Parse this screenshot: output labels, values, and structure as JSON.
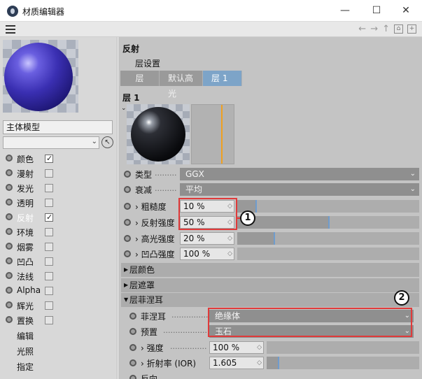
{
  "window": {
    "title": "材质编辑器",
    "controls": {
      "minimize": "—",
      "maximize": "☐",
      "close": "✕"
    }
  },
  "toolbar": {
    "icons": [
      "menu-icon",
      "back-arrow-icon",
      "forward-arrow-icon",
      "up-arrow-icon",
      "lock-icon",
      "new-window-icon"
    ],
    "back": "←",
    "forward": "→",
    "up": "↑",
    "lock": "🔒",
    "new_window": "⊞"
  },
  "left": {
    "material_name": "主体模型",
    "channels": [
      {
        "label": "颜色",
        "checked": true
      },
      {
        "label": "漫射",
        "checked": false
      },
      {
        "label": "发光",
        "checked": false
      },
      {
        "label": "透明",
        "checked": false
      },
      {
        "label": "反射",
        "checked": true,
        "active": true
      },
      {
        "label": "环境",
        "checked": false
      },
      {
        "label": "烟雾",
        "checked": false
      },
      {
        "label": "凹凸",
        "checked": false
      },
      {
        "label": "法线",
        "checked": false
      },
      {
        "label": "Alpha",
        "checked": false
      },
      {
        "label": "辉光",
        "checked": false
      },
      {
        "label": "置换",
        "checked": false
      }
    ],
    "extra_items": [
      "编辑",
      "光照",
      "指定"
    ]
  },
  "right": {
    "section_title": "反射",
    "layer_settings_label": "层设置",
    "layer_tabs": [
      "层",
      "默认高光",
      "层 1"
    ],
    "layer_header": "层 1",
    "type_label": "类型",
    "type_value": "GGX",
    "attenuation_label": "衰减",
    "attenuation_value": "平均",
    "roughness_label": "› 粗糙度",
    "roughness_value": "10 %",
    "roughness": 0.1,
    "reflect_label": "› 反射强度",
    "reflect_value": "50 %",
    "reflect": 0.5,
    "specular_label": "› 高光强度",
    "specular_value": "20 %",
    "specular": 0.2,
    "bump_label": "› 凹凸强度",
    "bump_value": "100 %",
    "bump": 1.0,
    "groups": [
      "层颜色",
      "层遮罩",
      "层菲涅耳"
    ],
    "fresnel_label": "菲涅耳",
    "fresnel_value": "绝缘体",
    "preset_label": "预置",
    "preset_value": "玉石",
    "strength_label": "› 强度",
    "strength_value": "100 %",
    "ior_label": "› 折射率 (IOR)",
    "ior_value": "1.605",
    "last_label": "反向"
  },
  "callouts": [
    "1",
    "2"
  ],
  "colors": {
    "highlight_tab": "#7da4c8",
    "annotation": "#e03a3a",
    "falloff_line": "#f0a020"
  }
}
